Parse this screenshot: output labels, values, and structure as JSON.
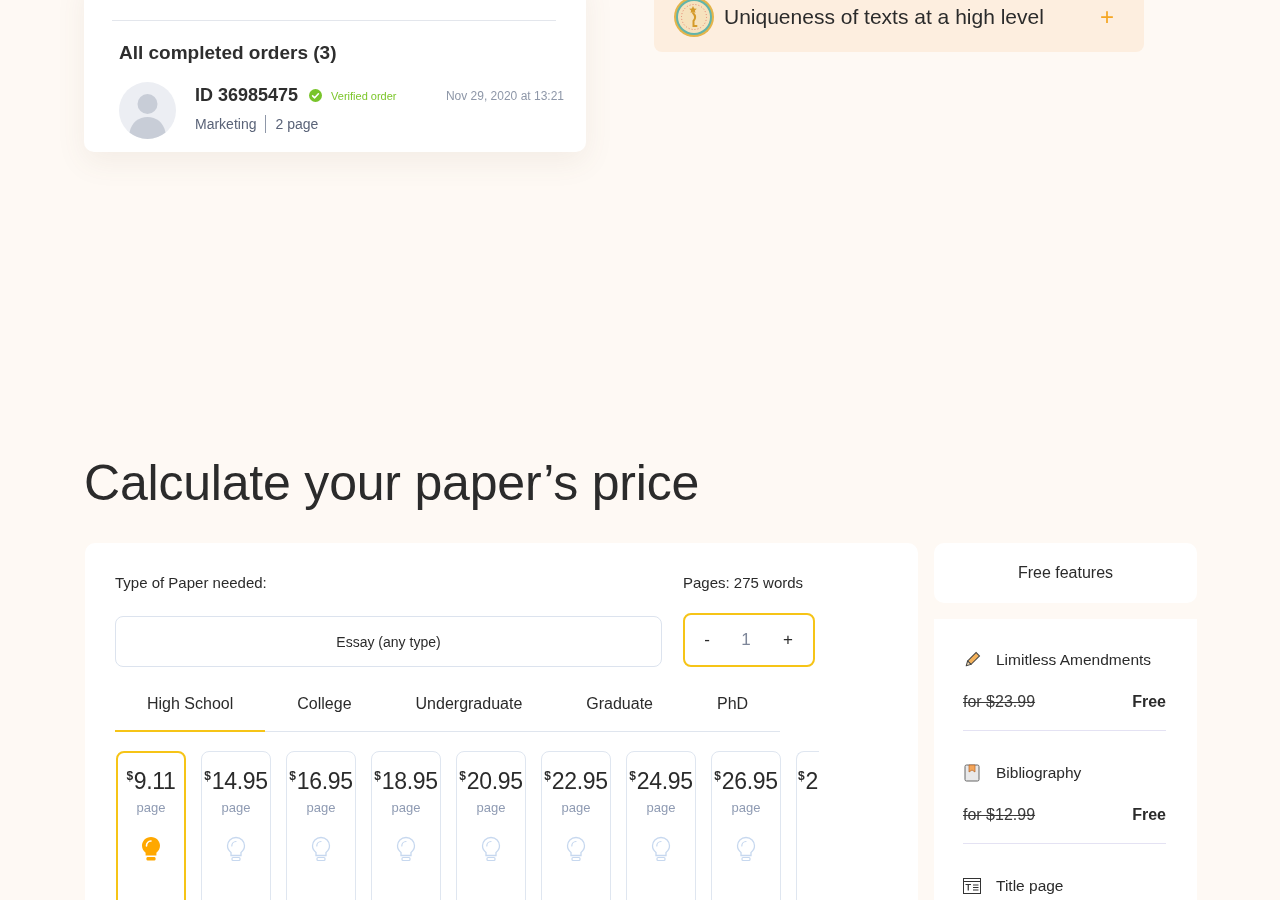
{
  "order_card": {
    "title": "All completed orders (3)",
    "order": {
      "id": "ID 36985475",
      "status": "Verified order",
      "date": "Nov 29, 2020 at 13:21",
      "subject": "Marketing",
      "pages": "2 page"
    }
  },
  "feature_banner": {
    "text": "Uniqueness of texts at a high level",
    "toggle": "+"
  },
  "calculator": {
    "title": "Calculate your paper’s price",
    "paper_type": {
      "label": "Type of Paper needed:",
      "value": "Essay (any type)"
    },
    "pages": {
      "label": "Pages: 275 words",
      "decrement": "-",
      "value": "1",
      "increment": "+"
    },
    "levels": [
      {
        "label": "High School",
        "selected": true
      },
      {
        "label": "College",
        "selected": false
      },
      {
        "label": "Undergraduate",
        "selected": false
      },
      {
        "label": "Graduate",
        "selected": false
      },
      {
        "label": "PhD",
        "selected": false
      }
    ],
    "prices": [
      {
        "kind": "full",
        "currency": "$",
        "price": "9.11",
        "unit": "page",
        "selected": true
      },
      {
        "kind": "full",
        "currency": "$",
        "price": "14.95",
        "unit": "page",
        "selected": false
      },
      {
        "kind": "full",
        "currency": "$",
        "price": "16.95",
        "unit": "page",
        "selected": false
      },
      {
        "kind": "full",
        "currency": "$",
        "price": "18.95",
        "unit": "page",
        "selected": false
      },
      {
        "kind": "full",
        "currency": "$",
        "price": "20.95",
        "unit": "page",
        "selected": false
      },
      {
        "kind": "full",
        "currency": "$",
        "price": "22.95",
        "unit": "page",
        "selected": false
      },
      {
        "kind": "full",
        "currency": "$",
        "price": "24.95",
        "unit": "page",
        "selected": false
      },
      {
        "kind": "full",
        "currency": "$",
        "price": "26.95",
        "unit": "page",
        "selected": false
      },
      {
        "kind": "clipped",
        "currency": "$",
        "price": "2",
        "selected": false
      }
    ]
  },
  "free_features": {
    "title": "Free features",
    "items": [
      {
        "name": "Limitless Amendments",
        "old_price": "for $23.99",
        "price": "Free"
      },
      {
        "name": "Bibliography",
        "old_price": "for $12.99",
        "price": "Free"
      },
      {
        "name": "Title page"
      }
    ]
  }
}
